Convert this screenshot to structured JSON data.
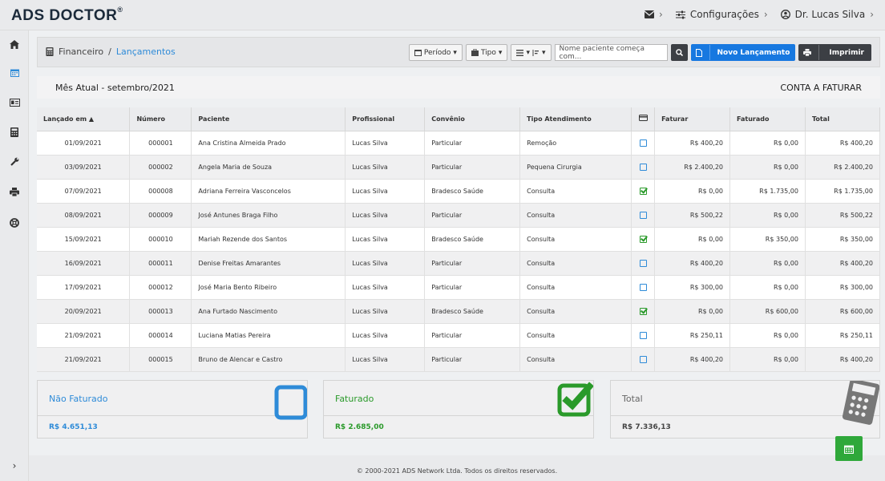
{
  "app": {
    "logo": "ADS DOCTOR",
    "logo_mark": "®"
  },
  "topnav": {
    "config_label": "Configurações",
    "user_label": "Dr. Lucas Silva",
    "chevron": "›"
  },
  "breadcrumb": {
    "root": "Financeiro",
    "separator": "/",
    "current": "Lançamentos"
  },
  "toolbar": {
    "periodo_label": "Período",
    "tipo_label": "Tipo",
    "search_placeholder": "Nome paciente começa com...",
    "novo_label": "Novo Lançamento",
    "imprimir_label": "Imprimir"
  },
  "month_bar": {
    "title": "Mês Atual - setembro/2021",
    "status": "CONTA A FATURAR"
  },
  "table": {
    "headers": [
      "Lançado em ▲",
      "Número",
      "Paciente",
      "Profissional",
      "Convênio",
      "Tipo Atendimento",
      "",
      "Faturar",
      "Faturado",
      "Total"
    ],
    "rows": [
      {
        "date": "01/09/2021",
        "num": "000001",
        "paciente": "Ana Cristina Almeida Prado",
        "prof": "Lucas Silva",
        "conv": "Particular",
        "tipo": "Remoção",
        "faturado": false,
        "faturar": "R$ 400,20",
        "fat": "R$ 0,00",
        "total": "R$ 400,20"
      },
      {
        "date": "03/09/2021",
        "num": "000002",
        "paciente": "Angela Maria de Souza",
        "prof": "Lucas Silva",
        "conv": "Particular",
        "tipo": "Pequena Cirurgia",
        "faturado": false,
        "faturar": "R$ 2.400,20",
        "fat": "R$ 0,00",
        "total": "R$ 2.400,20"
      },
      {
        "date": "07/09/2021",
        "num": "000008",
        "paciente": "Adriana Ferreira Vasconcelos",
        "prof": "Lucas Silva",
        "conv": "Bradesco Saúde",
        "tipo": "Consulta",
        "faturado": true,
        "faturar": "R$ 0,00",
        "fat": "R$ 1.735,00",
        "total": "R$ 1.735,00"
      },
      {
        "date": "08/09/2021",
        "num": "000009",
        "paciente": "José Antunes Braga Filho",
        "prof": "Lucas Silva",
        "conv": "Particular",
        "tipo": "Consulta",
        "faturado": false,
        "faturar": "R$ 500,22",
        "fat": "R$ 0,00",
        "total": "R$ 500,22"
      },
      {
        "date": "15/09/2021",
        "num": "000010",
        "paciente": "Mariah Rezende dos Santos",
        "prof": "Lucas Silva",
        "conv": "Bradesco Saúde",
        "tipo": "Consulta",
        "faturado": true,
        "faturar": "R$ 0,00",
        "fat": "R$ 350,00",
        "total": "R$ 350,00"
      },
      {
        "date": "16/09/2021",
        "num": "000011",
        "paciente": "Denise Freitas Amarantes",
        "prof": "Lucas Silva",
        "conv": "Particular",
        "tipo": "Consulta",
        "faturado": false,
        "faturar": "R$ 400,20",
        "fat": "R$ 0,00",
        "total": "R$ 400,20"
      },
      {
        "date": "17/09/2021",
        "num": "000012",
        "paciente": "José Maria Bento Ribeiro",
        "prof": "Lucas Silva",
        "conv": "Particular",
        "tipo": "Consulta",
        "faturado": false,
        "faturar": "R$ 300,00",
        "fat": "R$ 0,00",
        "total": "R$ 300,00"
      },
      {
        "date": "20/09/2021",
        "num": "000013",
        "paciente": "Ana Furtado Nascimento",
        "prof": "Lucas Silva",
        "conv": "Bradesco Saúde",
        "tipo": "Consulta",
        "faturado": true,
        "faturar": "R$ 0,00",
        "fat": "R$ 600,00",
        "total": "R$ 600,00"
      },
      {
        "date": "21/09/2021",
        "num": "000014",
        "paciente": "Luciana Matias Pereira",
        "prof": "Lucas Silva",
        "conv": "Particular",
        "tipo": "Consulta",
        "faturado": false,
        "faturar": "R$ 250,11",
        "fat": "R$ 0,00",
        "total": "R$ 250,11"
      },
      {
        "date": "21/09/2021",
        "num": "000015",
        "paciente": "Bruno de Alencar e Castro",
        "prof": "Lucas Silva",
        "conv": "Particular",
        "tipo": "Consulta",
        "faturado": false,
        "faturar": "R$ 400,20",
        "fat": "R$ 0,00",
        "total": "R$ 400,20"
      }
    ]
  },
  "cards": [
    {
      "title": "Não Faturado",
      "value": "R$ 4.651,13",
      "color": "#2e8bd8"
    },
    {
      "title": "Faturado",
      "value": "R$ 2.685,00",
      "color": "#2a9a2a"
    },
    {
      "title": "Total",
      "value": "R$ 7.336,13",
      "color": "#555555"
    }
  ],
  "footer": {
    "text": "© 2000-2021 ADS Network Ltda. Todos os direitos reservados."
  },
  "sidebar": {
    "icons": [
      "home-icon",
      "calendar-icon",
      "id-card-icon",
      "calculator-icon",
      "wrench-icon",
      "printer-icon",
      "lifebuoy-icon"
    ],
    "expand": "›"
  },
  "colors": {
    "accent": "#1778e0",
    "link": "#2e8bd8",
    "success": "#2fa83a",
    "dark": "#3c3f44"
  }
}
